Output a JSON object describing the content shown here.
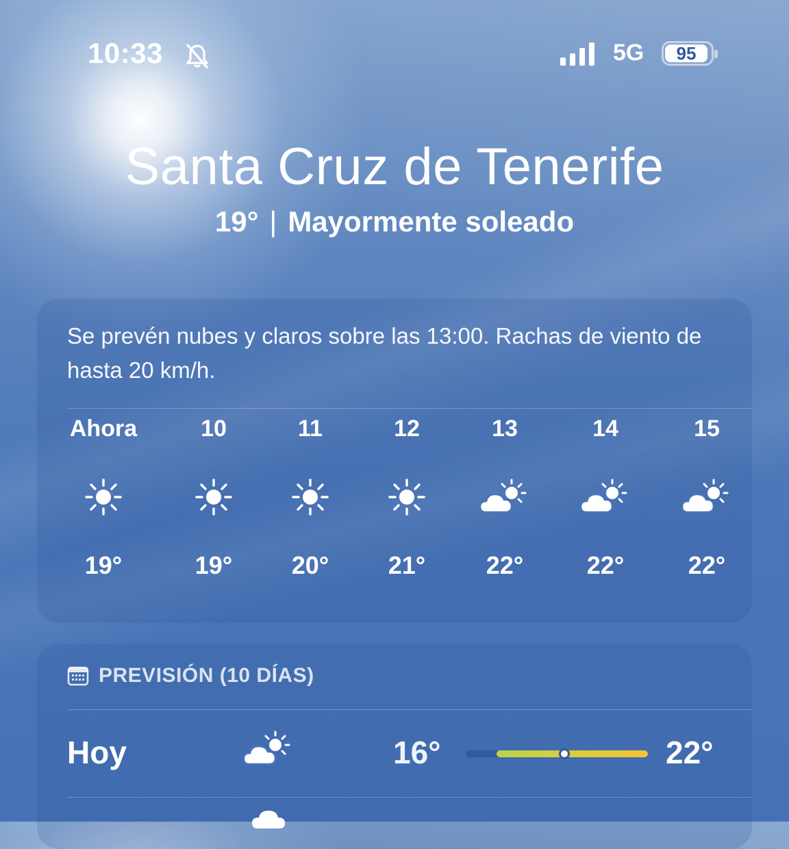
{
  "status_bar": {
    "time": "10:33",
    "network": "5G",
    "battery": "95",
    "signal_bars": 4
  },
  "location": {
    "city": "Santa Cruz de Tenerife",
    "current_temp": "19°",
    "separator": "|",
    "condition": "Mayormente soleado"
  },
  "hourly": {
    "summary": "Se prevén nubes y claros sobre las 13:00. Rachas de viento de hasta 20 km/h.",
    "items": [
      {
        "label": "Ahora",
        "icon": "sun-icon",
        "temp": "19°"
      },
      {
        "label": "10",
        "icon": "sun-icon",
        "temp": "19°"
      },
      {
        "label": "11",
        "icon": "sun-icon",
        "temp": "20°"
      },
      {
        "label": "12",
        "icon": "sun-icon",
        "temp": "21°"
      },
      {
        "label": "13",
        "icon": "partly-cloudy-icon",
        "temp": "22°"
      },
      {
        "label": "14",
        "icon": "partly-cloudy-icon",
        "temp": "22°"
      },
      {
        "label": "15",
        "icon": "partly-cloudy-icon",
        "temp": "22°"
      }
    ]
  },
  "forecast": {
    "header": "PREVISIÓN (10 DÍAS)",
    "header_icon": "calendar-icon",
    "days": [
      {
        "day": "Hoy",
        "icon": "partly-cloudy-icon",
        "low": "16°",
        "high": "22°",
        "range_start": 0.17,
        "range_end": 1.0,
        "current_position": 0.54
      }
    ],
    "next_row_icon": "cloud-icon"
  },
  "colors": {
    "range_start": "#bcd54a",
    "range_end": "#f6c431",
    "sky_top": "#7d9fcb",
    "sky_bottom": "#4672b5"
  }
}
